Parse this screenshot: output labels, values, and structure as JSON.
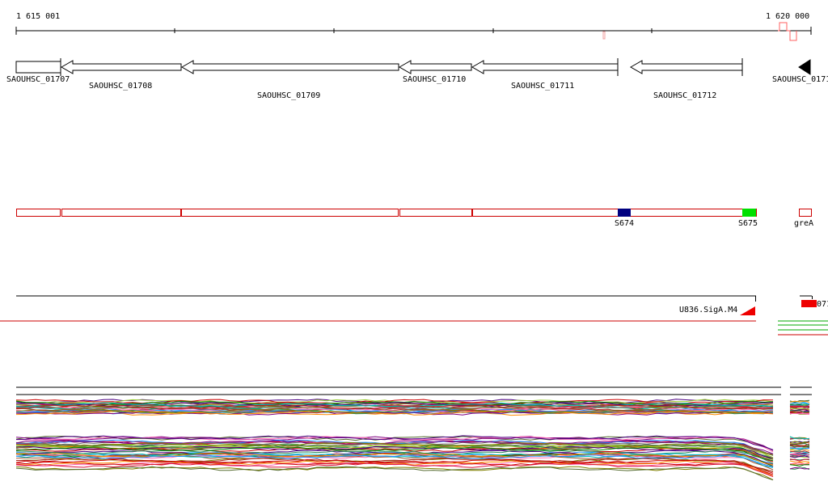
{
  "ruler": {
    "start_label": "1 615 001",
    "end_label": "1 620 000"
  },
  "genes": [
    {
      "label": "SAOUHSC_01707",
      "strand": "+"
    },
    {
      "label": "SAOUHSC_01708",
      "strand": "-"
    },
    {
      "label": "SAOUHSC_01709",
      "strand": "-"
    },
    {
      "label": "SAOUHSC_01710",
      "strand": "-"
    },
    {
      "label": "SAOUHSC_01711",
      "strand": "-"
    },
    {
      "label": "SAOUHSC_01712",
      "strand": "-"
    },
    {
      "label": "SAOUHSC_0171",
      "strand": "-"
    }
  ],
  "features": {
    "s674_label": "S674",
    "s675_label": "S675",
    "grea_label": "greA"
  },
  "regulatory": {
    "left_label": "U836.SigA.M4",
    "right_label": "071"
  },
  "colors": {
    "outline": "#cc0000",
    "s674": "#000080",
    "s675": "#00e000",
    "promoter": "#ee0000",
    "track_line": "#000000"
  },
  "expression_colors": [
    "#cc0000",
    "#008000",
    "#800080",
    "#ff8c00",
    "#1e90ff",
    "#808000",
    "#ff69b4",
    "#4b0082",
    "#2e8b57",
    "#a0522d",
    "#00bfbf",
    "#b22222",
    "#9acd32",
    "#696969",
    "#dc143c",
    "#556b2f"
  ]
}
